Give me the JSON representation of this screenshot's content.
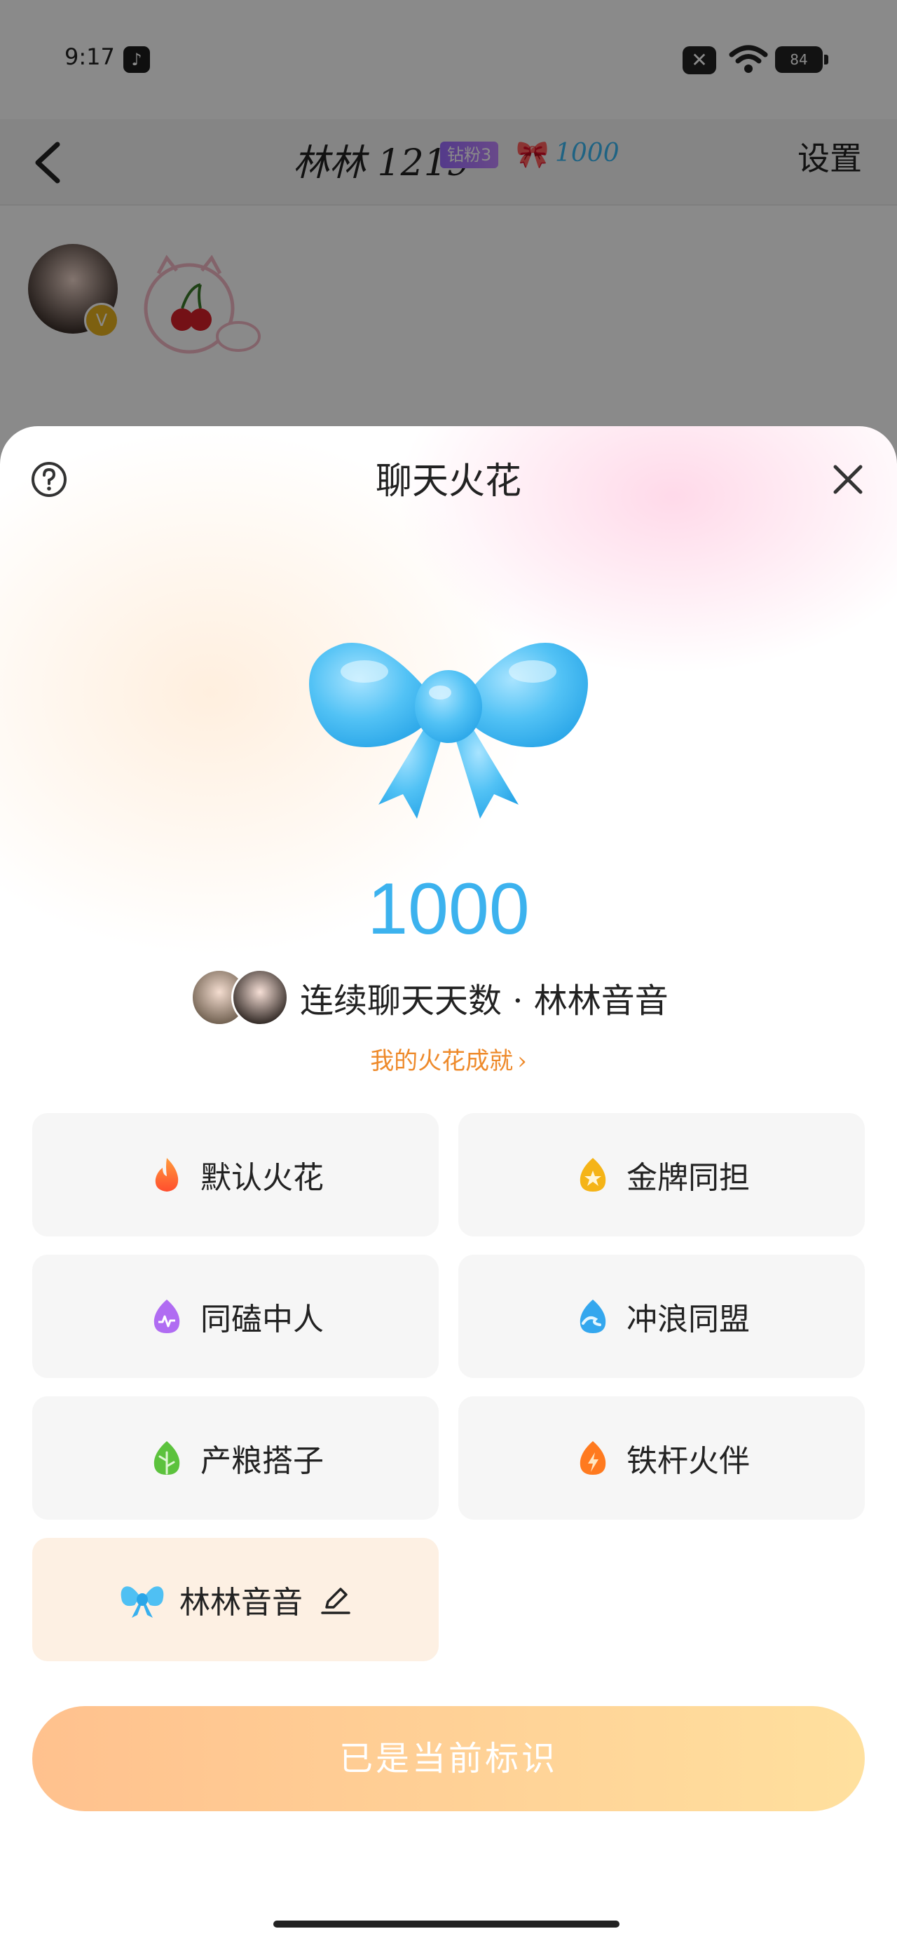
{
  "status_bar": {
    "time": "9:17",
    "battery": "84"
  },
  "chat_header": {
    "title": "林林 1219",
    "badge": "钻粉3",
    "spark_count": "1000",
    "settings_label": "设置"
  },
  "sheet": {
    "title": "聊天火花",
    "streak_count": "1000",
    "streak_label": "连续聊天天数 · 林林音音",
    "achievements_link": "我的火花成就",
    "options": [
      {
        "label": "默认火花",
        "icon": "flame-icon"
      },
      {
        "label": "金牌同担",
        "icon": "gold-star-flame-icon"
      },
      {
        "label": "同磕中人",
        "icon": "purple-flame-icon"
      },
      {
        "label": "冲浪同盟",
        "icon": "wave-flame-icon"
      },
      {
        "label": "产粮搭子",
        "icon": "green-leaf-flame-icon"
      },
      {
        "label": "铁杆火伴",
        "icon": "lightning-flame-icon"
      },
      {
        "label": "林林音音",
        "icon": "blue-bow-icon",
        "selected": true
      }
    ],
    "primary_button": "已是当前标识"
  },
  "colors": {
    "accent_blue": "#3cb2ee",
    "accent_orange": "#ee8a2b",
    "button_gradient_start": "#ffc18e",
    "button_gradient_end": "#ffe09e",
    "selected_card": "#fdf0e3"
  }
}
